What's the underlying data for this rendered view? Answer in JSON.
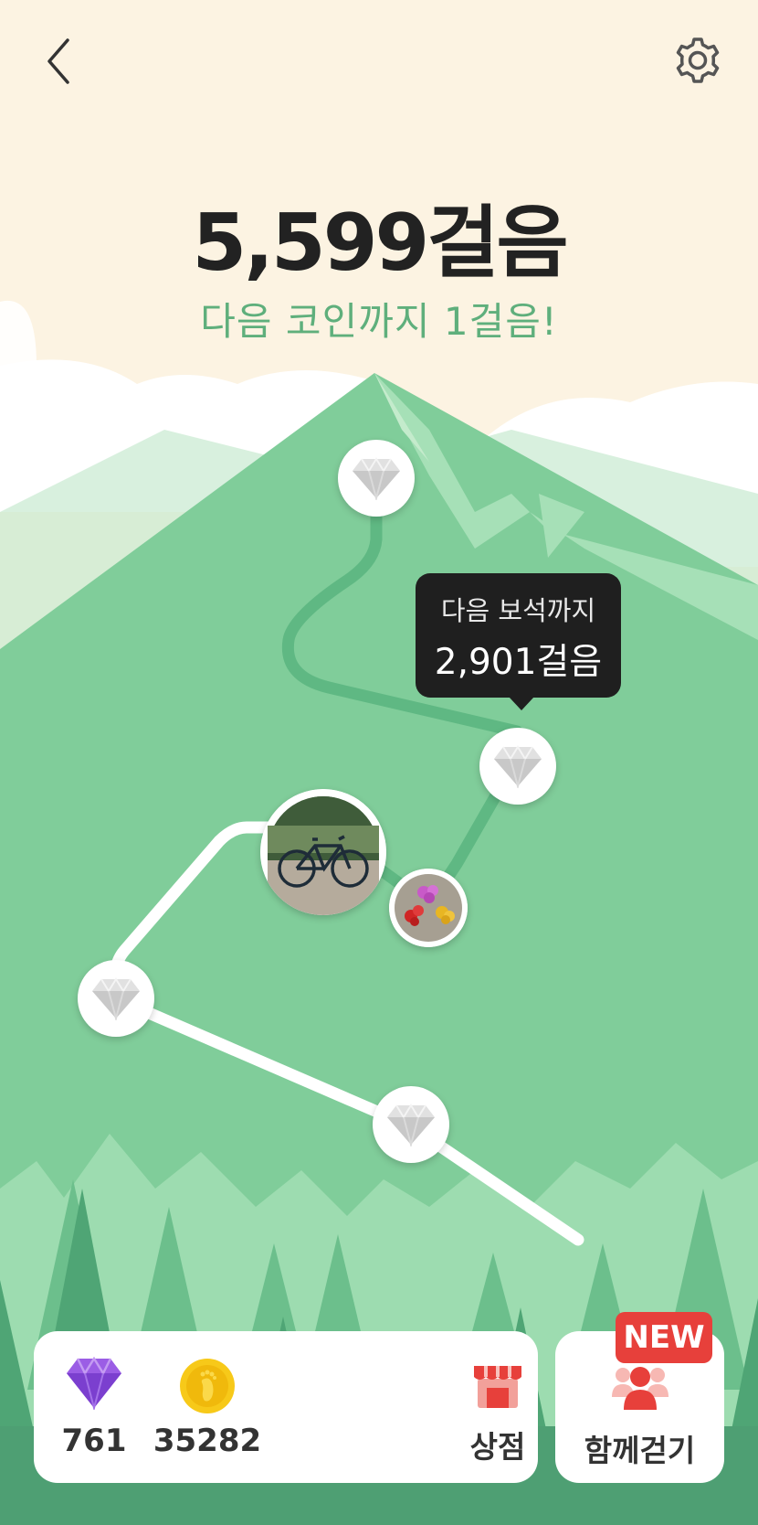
{
  "header": {
    "back_icon": "chevron-left-icon",
    "settings_icon": "gear-icon"
  },
  "progress": {
    "steps_text": "5,599걸음",
    "next_coin_text": "다음 코인까지 1걸음!"
  },
  "tooltip": {
    "line1": "다음 보석까지",
    "line2": "2,901걸음"
  },
  "wallet": {
    "gems": "761",
    "coins": "35282",
    "shop_label": "상점"
  },
  "together": {
    "label": "함께걷기",
    "badge": "NEW"
  },
  "colors": {
    "sky": "#fcf3e2",
    "mountain": "#7fcc99",
    "path_done": "#ffffff",
    "path_todo": "#5fb883",
    "accent_text": "#5faf7c",
    "badge": "#e7403b"
  }
}
